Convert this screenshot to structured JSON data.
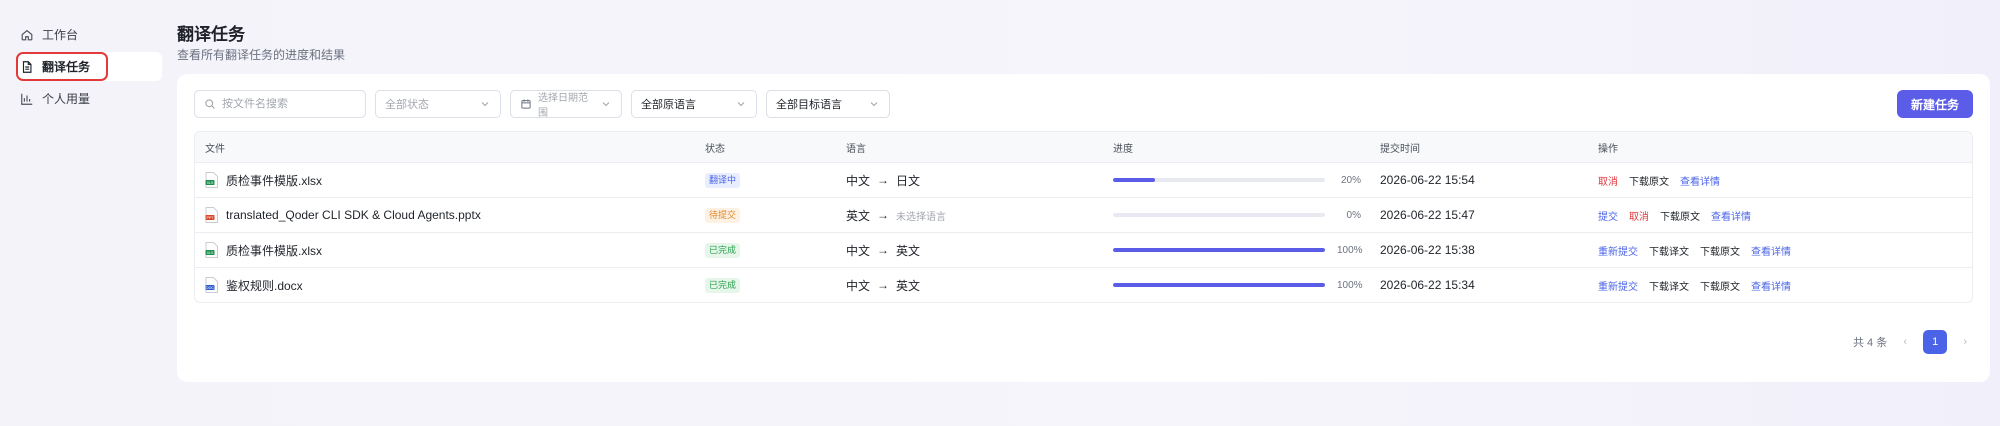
{
  "sidebar": {
    "items": [
      {
        "label": "工作台",
        "icon": "home-icon"
      },
      {
        "label": "翻译任务",
        "icon": "document-icon"
      },
      {
        "label": "个人用量",
        "icon": "bar-chart-icon"
      }
    ],
    "active_index": 1,
    "highlight_color": "#e23a3a"
  },
  "header": {
    "title": "翻译任务",
    "subtitle": "查看所有翻译任务的进度和结果"
  },
  "filters": {
    "search_placeholder": "按文件名搜索",
    "status_label": "全部状态",
    "date_label": "选择日期范围",
    "source_lang_label": "全部原语言",
    "target_lang_label": "全部目标语言"
  },
  "toolbar": {
    "new_task_label": "新建任务",
    "accent": "#5b5ce8"
  },
  "table": {
    "headers": {
      "file": "文件",
      "status": "状态",
      "language": "语言",
      "progress": "进度",
      "submitted": "提交时间",
      "actions": "操作"
    },
    "rows": [
      {
        "file": "质检事件模版.xlsx",
        "file_type": "xlsx",
        "status": "翻译中",
        "status_color": "blue",
        "src": "中文",
        "arrow": "→",
        "tgt": "日文",
        "tgt_muted": false,
        "progress": 20,
        "progress_text": "20%",
        "time": "2026-06-22 15:54",
        "actions": [
          {
            "label": "取消",
            "style": "red"
          },
          {
            "label": "下载原文",
            "style": "dark"
          },
          {
            "label": "查看详情",
            "style": "blue"
          }
        ]
      },
      {
        "file": "translated_Qoder CLI SDK & Cloud Agents.pptx",
        "file_type": "pptx",
        "status": "待提交",
        "status_color": "orange",
        "src": "英文",
        "arrow": "→",
        "tgt": "未选择语言",
        "tgt_muted": true,
        "progress": 0,
        "progress_text": "0%",
        "time": "2026-06-22 15:47",
        "actions": [
          {
            "label": "提交",
            "style": "blue"
          },
          {
            "label": "取消",
            "style": "red"
          },
          {
            "label": "下载原文",
            "style": "dark"
          },
          {
            "label": "查看详情",
            "style": "blue"
          }
        ]
      },
      {
        "file": "质检事件模版.xlsx",
        "file_type": "xlsx",
        "status": "已完成",
        "status_color": "green",
        "src": "中文",
        "arrow": "→",
        "tgt": "英文",
        "tgt_muted": false,
        "progress": 100,
        "progress_text": "100%",
        "time": "2026-06-22 15:38",
        "actions": [
          {
            "label": "重新提交",
            "style": "blue"
          },
          {
            "label": "下载译文",
            "style": "dark"
          },
          {
            "label": "下载原文",
            "style": "dark"
          },
          {
            "label": "查看详情",
            "style": "blue"
          }
        ]
      },
      {
        "file": "鉴权规则.docx",
        "file_type": "docx",
        "status": "已完成",
        "status_color": "green",
        "src": "中文",
        "arrow": "→",
        "tgt": "英文",
        "tgt_muted": false,
        "progress": 100,
        "progress_text": "100%",
        "time": "2026-06-22 15:34",
        "actions": [
          {
            "label": "重新提交",
            "style": "blue"
          },
          {
            "label": "下载译文",
            "style": "dark"
          },
          {
            "label": "下载原文",
            "style": "dark"
          },
          {
            "label": "查看详情",
            "style": "blue"
          }
        ]
      }
    ]
  },
  "pagination": {
    "total_text": "共 4 条",
    "current_page": "1",
    "prev": "‹",
    "next": "›"
  }
}
